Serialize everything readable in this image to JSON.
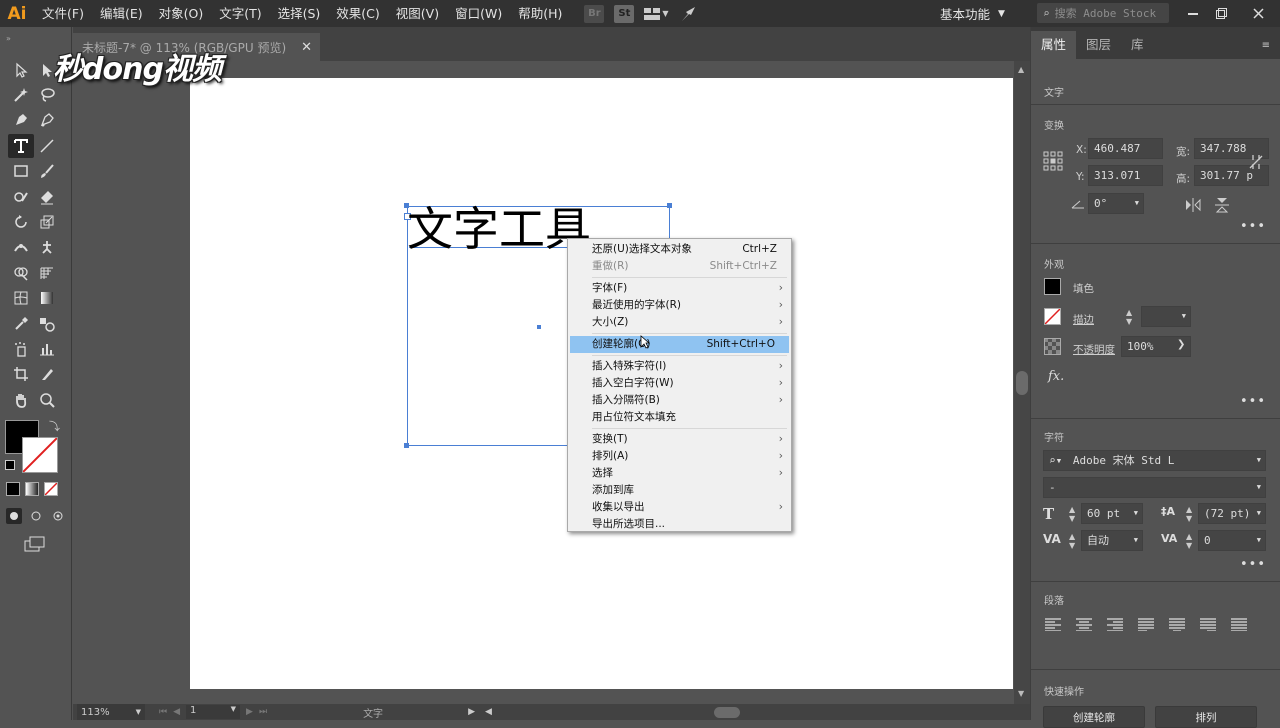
{
  "app": {
    "logo": "Ai"
  },
  "menu": [
    "文件(F)",
    "编辑(E)",
    "对象(O)",
    "文字(T)",
    "选择(S)",
    "效果(C)",
    "视图(V)",
    "窗口(W)",
    "帮助(H)"
  ],
  "menu_icons": {
    "br": "Br",
    "st": "St"
  },
  "workspace": {
    "label": "基本功能"
  },
  "search": {
    "placeholder": "搜索 Adobe Stock"
  },
  "doc_tab": {
    "title": "未标题-7* @ 113% (RGB/GPU 预览)"
  },
  "watermark": {
    "text": "秒dong视频"
  },
  "canvas": {
    "text": "文字工具"
  },
  "context_menu": [
    {
      "label": "还原(U)选择文本对象",
      "shortcut": "Ctrl+Z"
    },
    {
      "label": "重做(R)",
      "shortcut": "Shift+Ctrl+Z",
      "disabled": true
    },
    {
      "sep": true
    },
    {
      "label": "字体(F)",
      "submenu": true
    },
    {
      "label": "最近使用的字体(R)",
      "submenu": true
    },
    {
      "label": "大小(Z)",
      "submenu": true
    },
    {
      "sep": true
    },
    {
      "label": "创建轮廓(O)",
      "shortcut": "Shift+Ctrl+O",
      "highlighted": true
    },
    {
      "sep": true
    },
    {
      "label": "插入特殊字符(I)",
      "submenu": true
    },
    {
      "label": "插入空白字符(W)",
      "submenu": true
    },
    {
      "label": "插入分隔符(B)",
      "submenu": true
    },
    {
      "label": "用占位符文本填充"
    },
    {
      "sep": true
    },
    {
      "label": "变换(T)",
      "submenu": true
    },
    {
      "label": "排列(A)",
      "submenu": true
    },
    {
      "label": "选择",
      "submenu": true
    },
    {
      "label": "添加到库"
    },
    {
      "label": "收集以导出",
      "submenu": true
    },
    {
      "label": "导出所选项目..."
    }
  ],
  "status": {
    "zoom": "113%",
    "page": "1",
    "tool": "文字"
  },
  "panel": {
    "tabs": [
      "属性",
      "图层",
      "库"
    ],
    "section_text": "文字",
    "transform": {
      "title": "变换",
      "x_label": "X:",
      "x": "460.487",
      "y_label": "Y:",
      "y": "313.071",
      "w_label": "宽:",
      "w": "347.788",
      "h_label": "高:",
      "h": "301.77 p",
      "angle": "0°"
    },
    "appearance": {
      "title": "外观",
      "fill_label": "填色",
      "stroke_label": "描边",
      "opacity_label": "不透明度",
      "opacity": "100%",
      "fx": "fx."
    },
    "character": {
      "title": "字符",
      "font": "Adobe 宋体 Std L",
      "style": "-",
      "size": "60 pt",
      "leading": "(72 pt)",
      "kerning": "自动",
      "tracking": "0"
    },
    "paragraph": {
      "title": "段落"
    },
    "quick_actions": {
      "title": "快速操作",
      "btn1": "创建轮廓",
      "btn2": "排列"
    }
  },
  "colors": {
    "accent": "#8fc3f1",
    "selection": "#4a7fd4",
    "logo": "#f29b1d"
  }
}
